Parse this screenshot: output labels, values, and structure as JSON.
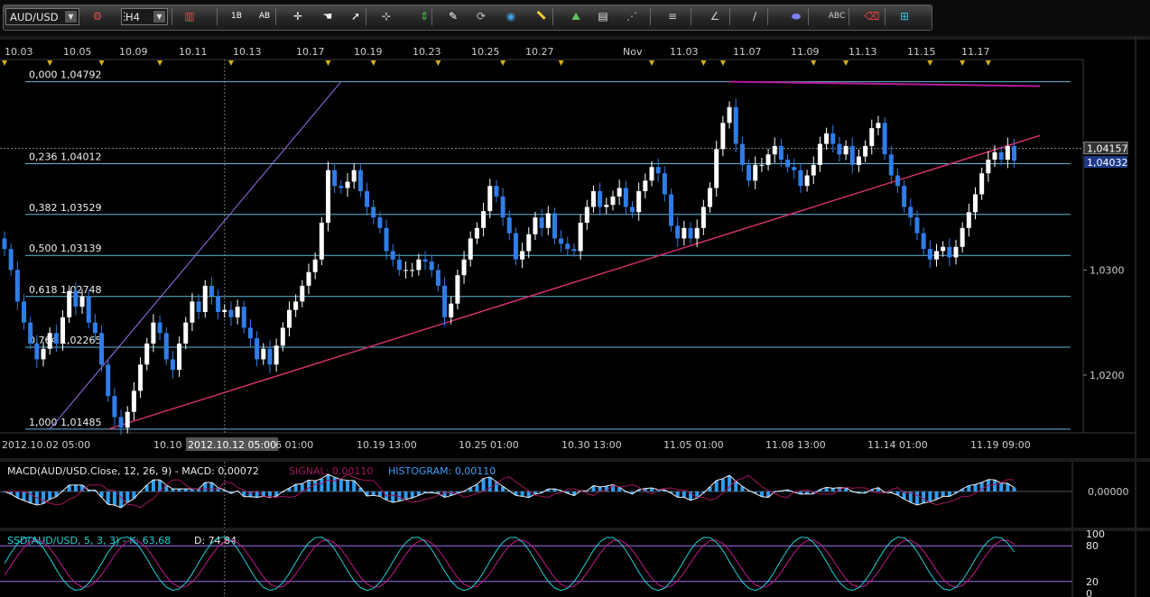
{
  "toolbar": {
    "symbol": "AUD/USD",
    "timeframe": "H4",
    "buttons": [
      {
        "name": "pair-settings-icon",
        "glyph": "⚙",
        "color": "#e05050"
      },
      {
        "name": "chart-type-icon",
        "glyph": "⋮",
        "color": "#d0d0d0"
      },
      {
        "name": "candles-icon",
        "glyph": "▥",
        "color": "#e05050"
      },
      {
        "name": "one-window-icon",
        "glyph": "1B",
        "color": "#ffffff"
      },
      {
        "name": "all-windows-icon",
        "glyph": "AB",
        "color": "#ffffff"
      },
      {
        "name": "crosshair-tool-icon",
        "glyph": "✛",
        "color": "#ffffff"
      },
      {
        "name": "hand-tool-icon",
        "glyph": "☚",
        "color": "#ffffff"
      },
      {
        "name": "cursor-tool-icon",
        "glyph": "➚",
        "color": "#ffffff"
      },
      {
        "name": "cross-cursor-icon",
        "glyph": "⊹",
        "color": "#ffffff"
      },
      {
        "name": "scale-icon",
        "glyph": "⇕",
        "color": "#40c040"
      },
      {
        "name": "eraser-icon",
        "glyph": "✎",
        "color": "#ffffff"
      },
      {
        "name": "rotate-icon",
        "glyph": "⟳",
        "color": "#c0c0c0"
      },
      {
        "name": "zoom-icon",
        "glyph": "◉",
        "color": "#40a0e0"
      },
      {
        "name": "ruler-icon",
        "glyph": "📏",
        "color": "#e0c040"
      },
      {
        "name": "indicator-icon",
        "glyph": "⛰",
        "color": "#60c060"
      },
      {
        "name": "template-icon",
        "glyph": "▤",
        "color": "#e0e0e0"
      },
      {
        "name": "fibonacci-icon",
        "glyph": "⋰",
        "color": "#c0c0c0"
      },
      {
        "name": "lines-icon",
        "glyph": "≡",
        "color": "#d0d0d0"
      },
      {
        "name": "channel-icon",
        "glyph": "∠",
        "color": "#d0d0d0"
      },
      {
        "name": "pen-icon",
        "glyph": "/",
        "color": "#d0d0d0"
      },
      {
        "name": "shape-icon",
        "glyph": "⬬",
        "color": "#8080ff"
      },
      {
        "name": "text-icon",
        "glyph": "ABC",
        "color": "#d0d0d0"
      },
      {
        "name": "delete-icon",
        "glyph": "⌫",
        "color": "#e04040"
      },
      {
        "name": "objects-icon",
        "glyph": "⊞",
        "color": "#40c0e0"
      }
    ]
  },
  "colors": {
    "background": "#000000",
    "grid": "#2e2e2e",
    "axis_text": "#cccccc",
    "up_candle": "#ffffff",
    "down_candle": "#2f7de8",
    "fib_line": "#62b8d8",
    "trend_line": "#d0306c",
    "fib_trend_line": "#9a72f0",
    "top_line": "#b8199a",
    "macd_hist": "#2f9cf0",
    "macd_line": "#f0f0f0",
    "signal_line": "#a3155f",
    "stoch_k": "#20d0d8",
    "stoch_signal": "#c01a8f",
    "event_marker": "#d6b01a"
  },
  "chart_data": [
    {
      "type": "candlestick",
      "symbol": "AUD/USD",
      "timeframe": "H4",
      "ylim": [
        1.0145,
        1.049
      ],
      "top_dates": [
        "10.03",
        "10.05",
        "10.09",
        "10.11",
        "10.13",
        "10.17",
        "10.19",
        "10.23",
        "10.25",
        "10.27",
        "Nov",
        "11.03",
        "11.07",
        "11.09",
        "11.13",
        "11.15",
        "11.17"
      ],
      "bottom_dates": [
        "2012.10.02 05:00",
        "10.10",
        "2012.10.12 05:00",
        "6 01:00",
        "10.19 13:00",
        "10.25 01:00",
        "10.30 13:00",
        "11.05 01:00",
        "11.08 13:00",
        "11.14 01:00",
        "11.19 09:00"
      ],
      "price_ticks": [
        "1,0300",
        "1,0200"
      ],
      "last_price": "1,04157",
      "bid_price": "1,04032",
      "fibonacci_levels": [
        {
          "label": "0,000 1,04792",
          "price": 1.04792
        },
        {
          "label": "0,236 1,04012",
          "price": 1.04012
        },
        {
          "label": "0,382 1,03529",
          "price": 1.03529
        },
        {
          "label": "0,500 1,03139",
          "price": 1.03139
        },
        {
          "label": "0,618 1,02748",
          "price": 1.02748
        },
        {
          "label": "0,764 1,02265",
          "price": 1.02265
        },
        {
          "label": "1,000 1,01485",
          "price": 1.01485
        }
      ],
      "closes": [
        1.032,
        1.03,
        1.027,
        1.025,
        1.023,
        1.0215,
        1.0225,
        1.024,
        1.023,
        1.0255,
        1.028,
        1.0265,
        1.0275,
        1.025,
        1.024,
        1.021,
        1.018,
        1.016,
        1.015,
        1.0165,
        1.0185,
        1.021,
        1.023,
        1.025,
        1.024,
        1.0215,
        1.0205,
        1.023,
        1.025,
        1.027,
        1.026,
        1.0285,
        1.0275,
        1.026,
        1.0262,
        1.0255,
        1.0265,
        1.0245,
        1.0235,
        1.0215,
        1.0225,
        1.021,
        1.0228,
        1.0245,
        1.0262,
        1.027,
        1.0285,
        1.0298,
        1.031,
        1.0345,
        1.0395,
        1.038,
        1.0378,
        1.0384,
        1.0395,
        1.0375,
        1.036,
        1.035,
        1.034,
        1.0318,
        1.031,
        1.03,
        1.03,
        1.03,
        1.031,
        1.0308,
        1.03,
        1.0285,
        1.0255,
        1.0268,
        1.0295,
        1.031,
        1.033,
        1.034,
        1.0356,
        1.038,
        1.037,
        1.035,
        1.0335,
        1.031,
        1.0318,
        1.0334,
        1.035,
        1.034,
        1.0354,
        1.033,
        1.0325,
        1.032,
        1.0318,
        1.0345,
        1.036,
        1.0375,
        1.036,
        1.0362,
        1.037,
        1.0378,
        1.036,
        1.0355,
        1.0375,
        1.0385,
        1.0398,
        1.0392,
        1.0372,
        1.0342,
        1.033,
        1.034,
        1.033,
        1.034,
        1.036,
        1.0378,
        1.0415,
        1.044,
        1.0455,
        1.042,
        1.04,
        1.0385,
        1.04,
        1.04,
        1.041,
        1.0418,
        1.0405,
        1.0398,
        1.0395,
        1.038,
        1.039,
        1.04,
        1.042,
        1.043,
        1.042,
        1.041,
        1.0418,
        1.04,
        1.0408,
        1.0418,
        1.0435,
        1.044,
        1.041,
        1.039,
        1.038,
        1.036,
        1.035,
        1.0335,
        1.032,
        1.031,
        1.0318,
        1.0322,
        1.0312,
        1.0322,
        1.034,
        1.0355,
        1.0372,
        1.0392,
        1.0405,
        1.0412,
        1.0405,
        1.0418,
        1.0404
      ],
      "opens_first": 1.033,
      "ranges": [
        0.0015,
        0.0012,
        0.0018
      ],
      "trend_line": {
        "from": [
          16,
          1.01485
        ],
        "to": [
          160,
          1.0428
        ]
      },
      "fib_trend_line": {
        "from": [
          7,
          1.01485
        ],
        "to": [
          52,
          1.04792
        ]
      },
      "top_line": {
        "from": [
          112,
          1.04792
        ],
        "to": [
          160,
          1.0475
        ]
      },
      "event_markers": [
        0,
        7,
        15,
        24,
        35,
        50,
        57,
        67,
        77,
        86,
        100,
        108,
        111,
        125,
        130,
        143,
        148,
        152
      ],
      "vertical_marker_index": 34
    },
    {
      "type": "histogram",
      "title": "MACD(AUD/USD.Close, 12, 26, 9)",
      "value_label": "MACD: 0,00072",
      "extra_label": "SIGNAL: 0,00110",
      "histogram_label": "HISTOGRAM: 0,00110",
      "tick": "0,00000",
      "ylim": [
        -0.0025,
        0.0025
      ]
    },
    {
      "type": "line",
      "title": "SSD(AUD/USD, 5, 3, 3)",
      "k_label": "K: 63,68",
      "d_label": "D: 74,84",
      "ticks": [
        "100",
        "80",
        "20",
        "0"
      ],
      "ylim": [
        0,
        100
      ]
    }
  ]
}
